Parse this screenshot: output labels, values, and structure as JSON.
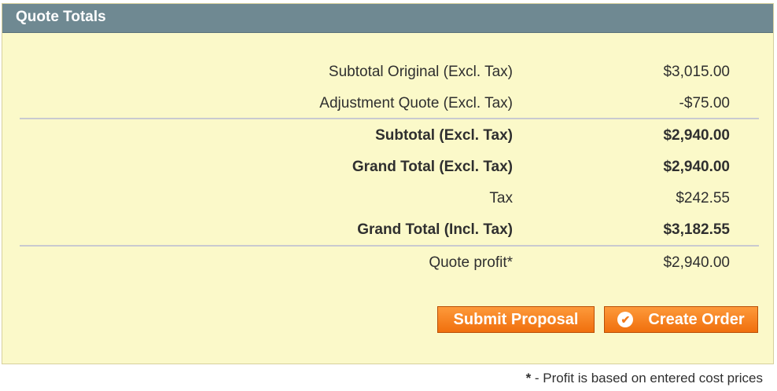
{
  "panel": {
    "title": "Quote Totals"
  },
  "totals": {
    "subtotal_original": {
      "label": "Subtotal Original (Excl. Tax)",
      "value": "$3,015.00"
    },
    "adjustment": {
      "label": "Adjustment Quote (Excl. Tax)",
      "value": "-$75.00"
    },
    "subtotal": {
      "label": "Subtotal (Excl. Tax)",
      "value": "$2,940.00"
    },
    "grand_total_excl": {
      "label": "Grand Total (Excl. Tax)",
      "value": "$2,940.00"
    },
    "tax": {
      "label": "Tax",
      "value": "$242.55"
    },
    "grand_total_incl": {
      "label": "Grand Total (Incl. Tax)",
      "value": "$3,182.55"
    },
    "quote_profit": {
      "label": "Quote profit*",
      "value": "$2,940.00"
    }
  },
  "buttons": {
    "submit_proposal": "Submit Proposal",
    "create_order": "Create Order",
    "create_order_icon": "checkmark-circle-icon"
  },
  "footnote": {
    "star": "*",
    "text": " - Profit is based on entered cost prices"
  },
  "colors": {
    "header_bg": "#6f8992",
    "panel_bg": "#fbf9c9",
    "button_orange": "#f27a1c"
  }
}
